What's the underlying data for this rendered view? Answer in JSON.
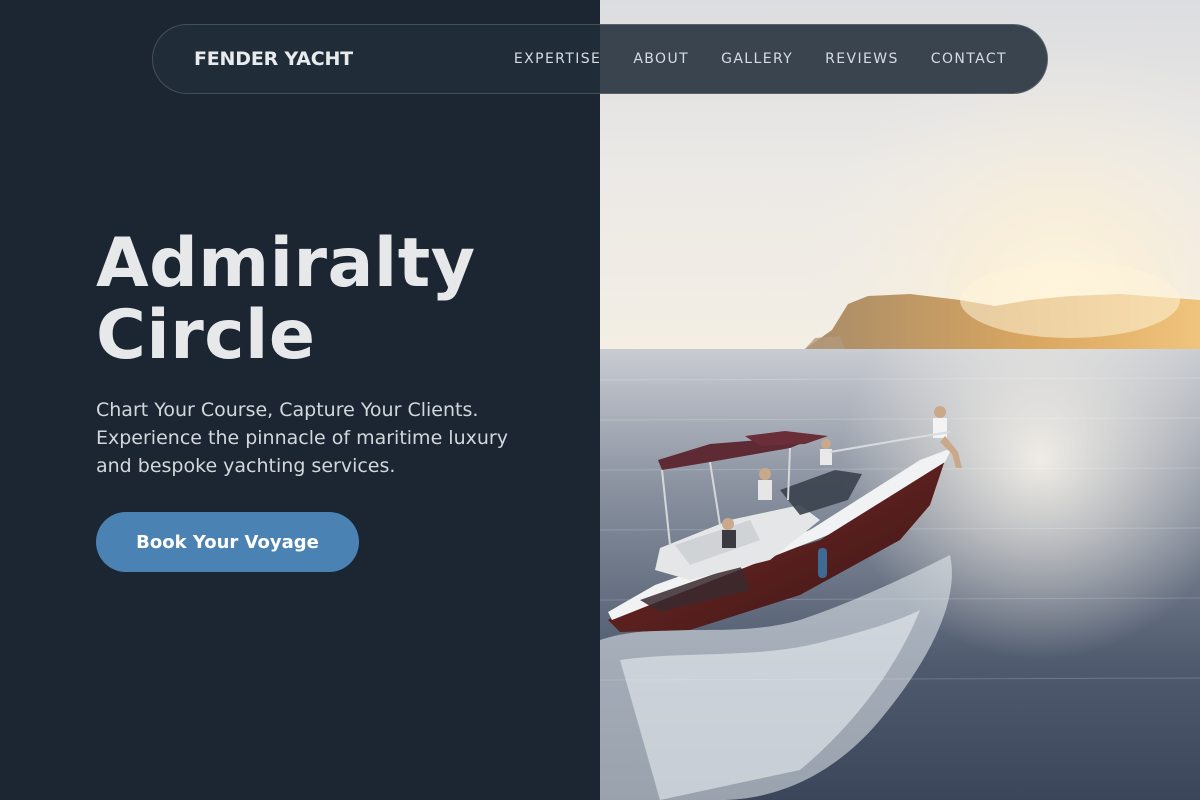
{
  "brand": {
    "name": "FENDER YACHT"
  },
  "nav": {
    "items": [
      {
        "label": "EXPERTISE"
      },
      {
        "label": "ABOUT"
      },
      {
        "label": "GALLERY"
      },
      {
        "label": "REVIEWS"
      },
      {
        "label": "CONTACT"
      }
    ]
  },
  "hero": {
    "title_line1": "Admiralty",
    "title_line2": "Circle",
    "subtitle": "Chart Your Course, Capture Your Clients. Experience the pinnacle of maritime luxury and bespoke yachting services.",
    "cta_label": "Book Your Voyage"
  },
  "colors": {
    "panel": "#1c2632",
    "accent": "#4a82b4",
    "text_light": "#e6e8ea"
  },
  "image": {
    "subject": "motor-yacht-at-sunset-photo"
  }
}
